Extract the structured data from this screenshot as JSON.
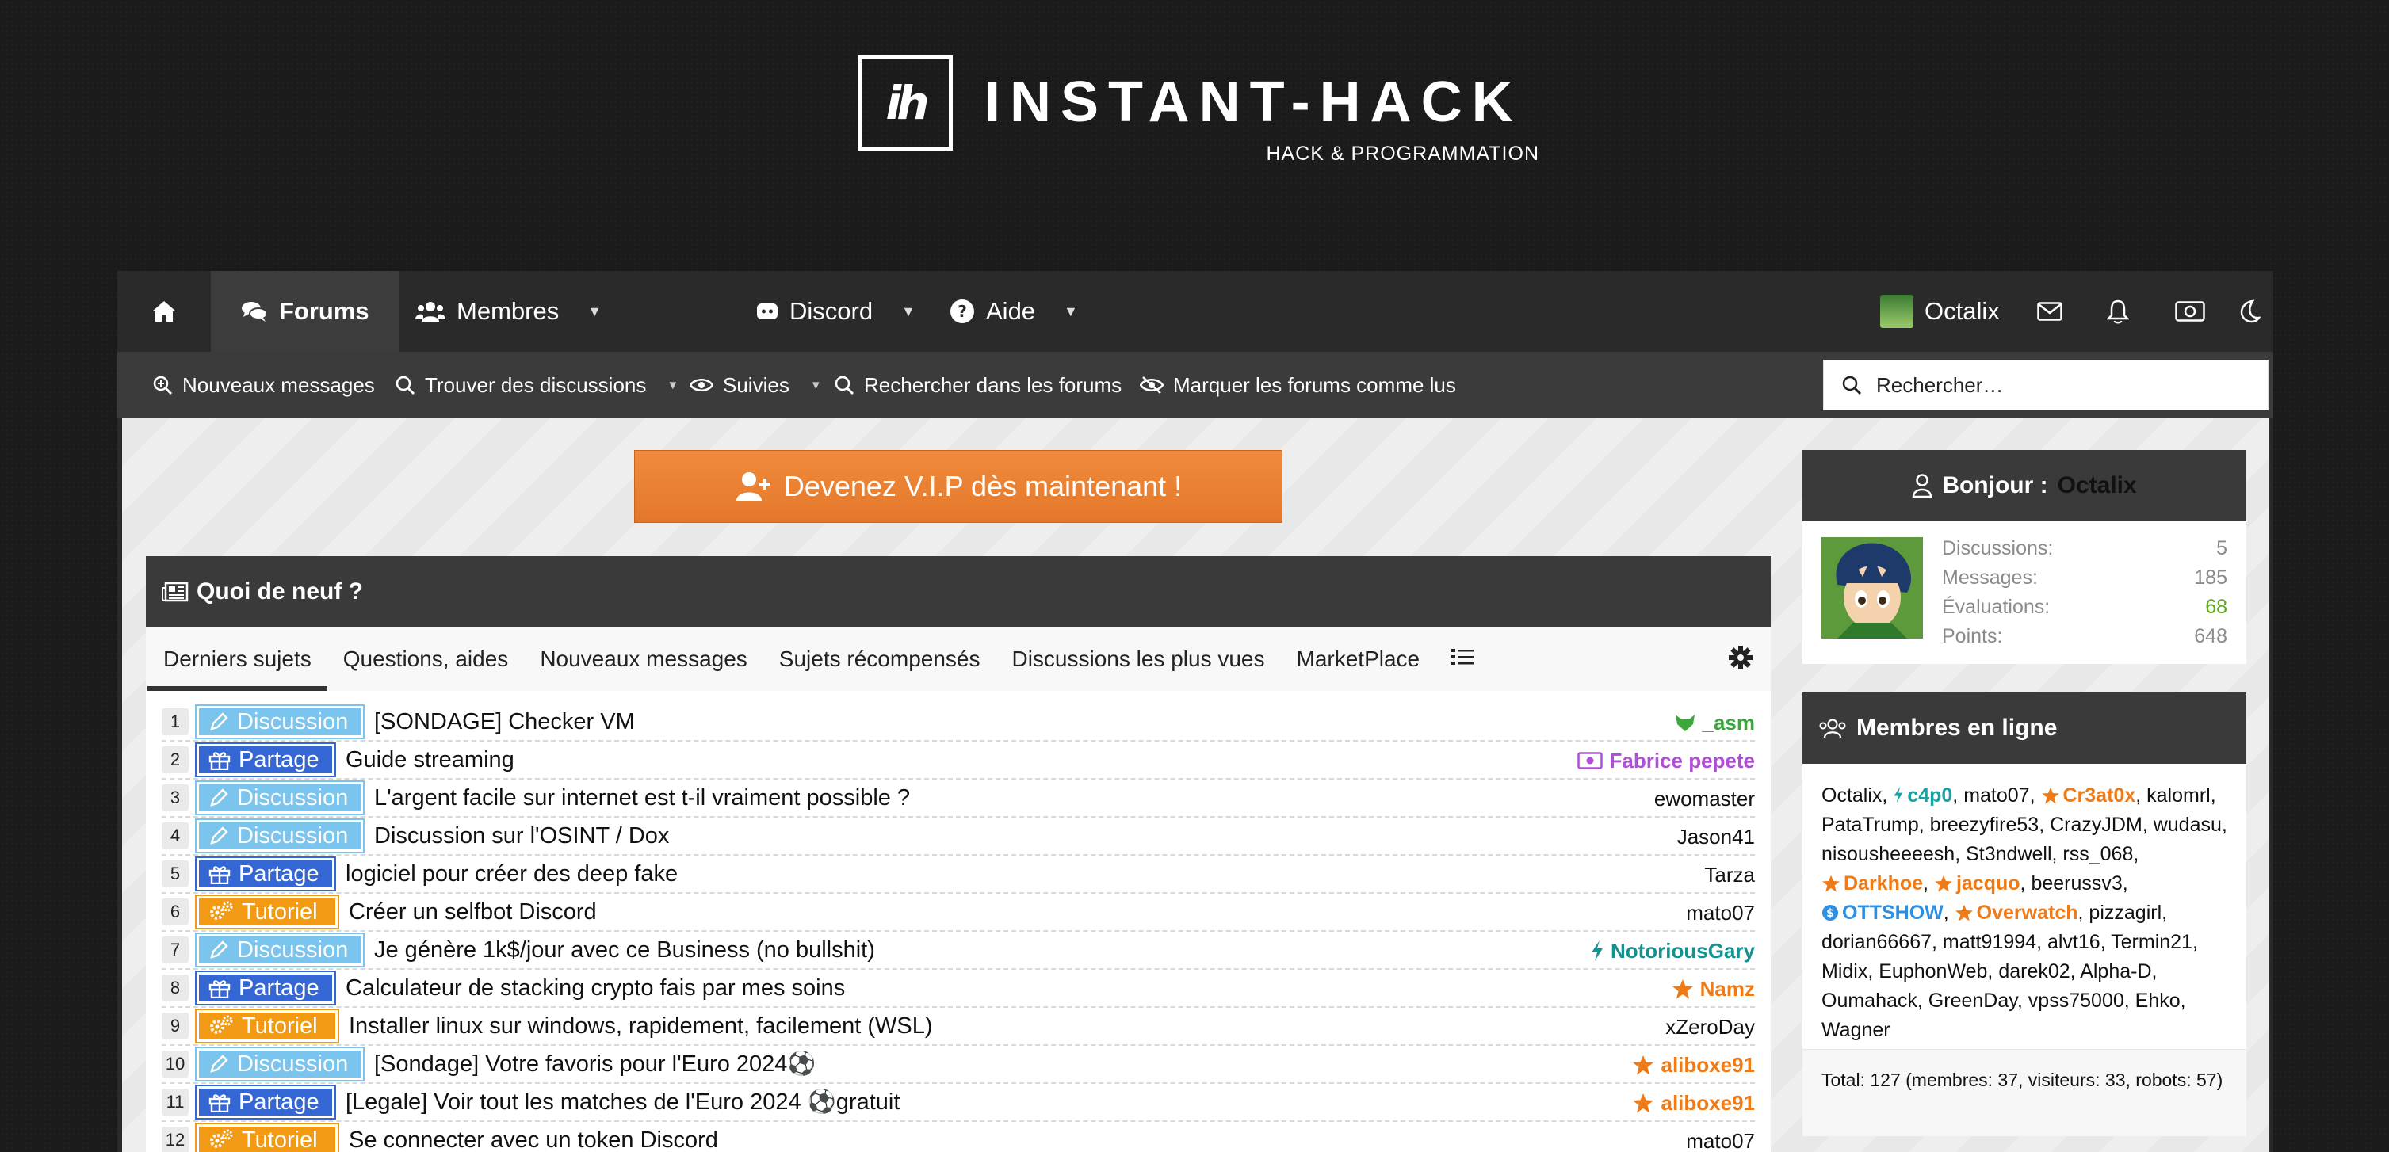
{
  "logo": {
    "mark": "ih",
    "title": "INSTANT-HACK",
    "subtitle": "HACK & PROGRAMMATION"
  },
  "nav": {
    "home_icon": "home-icon",
    "items": [
      {
        "label": "Forums",
        "icon": "comments-icon",
        "active": true
      },
      {
        "label": "Membres",
        "icon": "users-icon"
      },
      {
        "label": "Discord",
        "icon": "discord-icon"
      },
      {
        "label": "Aide",
        "icon": "question-icon"
      }
    ],
    "user": "Octalix"
  },
  "subnav": {
    "items": [
      "Nouveaux messages",
      "Trouver des discussions",
      "Suivies",
      "Rechercher dans les forums",
      "Marquer les forums comme lus"
    ],
    "search_placeholder": "Rechercher…"
  },
  "vip_button": "Devenez V.I.P dès maintenant !",
  "news": {
    "title": "Quoi de neuf ?",
    "tabs": [
      "Derniers sujets",
      "Questions, aides",
      "Nouveaux messages",
      "Sujets récompensés",
      "Discussions les plus vues",
      "MarketPlace"
    ],
    "threads": [
      {
        "n": "1",
        "prefix": "Discussion",
        "title": "[SONDAGE] Checker VM",
        "author": "_asm",
        "author_color": "#3aa83a",
        "badge": "fox"
      },
      {
        "n": "2",
        "prefix": "Partage",
        "title": "Guide streaming",
        "author": "Fabrice pepete",
        "author_color": "#b04fd6",
        "badge": "money"
      },
      {
        "n": "3",
        "prefix": "Discussion",
        "title": "L'argent facile sur internet est t-il vraiment possible ?",
        "author": "ewomaster",
        "author_color": "#111111",
        "badge": ""
      },
      {
        "n": "4",
        "prefix": "Discussion",
        "title": "Discussion sur l'OSINT / Dox",
        "author": "Jason41",
        "author_color": "#111111",
        "badge": ""
      },
      {
        "n": "5",
        "prefix": "Partage",
        "title": "logiciel pour créer des deep fake",
        "author": "Tarza",
        "author_color": "#111111",
        "badge": ""
      },
      {
        "n": "6",
        "prefix": "Tutoriel",
        "title": "Créer un selfbot Discord",
        "author": "mato07",
        "author_color": "#111111",
        "badge": ""
      },
      {
        "n": "7",
        "prefix": "Discussion",
        "title": "Je génère 1k$/jour avec ce Business (no bullshit)",
        "author": "NotoriousGary",
        "author_color": "#169191",
        "badge": "bolt"
      },
      {
        "n": "8",
        "prefix": "Partage",
        "title": "Calculateur de stacking crypto fais par mes soins",
        "author": "Namz",
        "author_color": "#f07a16",
        "badge": "star"
      },
      {
        "n": "9",
        "prefix": "Tutoriel",
        "title": "Installer linux sur windows, rapidement, facilement (WSL)",
        "author": "xZeroDay",
        "author_color": "#111111",
        "badge": ""
      },
      {
        "n": "10",
        "prefix": "Discussion",
        "title": "[Sondage] Votre favoris pour l'Euro 2024⚽",
        "author": "aliboxe91",
        "author_color": "#f07a16",
        "badge": "star"
      },
      {
        "n": "11",
        "prefix": "Partage",
        "title": "[Legale] Voir tout les matches de l'Euro 2024 ⚽gratuit",
        "author": "aliboxe91",
        "author_color": "#f07a16",
        "badge": "star"
      },
      {
        "n": "12",
        "prefix": "Tutoriel",
        "title": "Se connecter avec un token Discord",
        "author": "mato07",
        "author_color": "#111111",
        "badge": ""
      }
    ]
  },
  "sidebar": {
    "greeting": "Bonjour :",
    "user": "Octalix",
    "stats": [
      {
        "label": "Discussions:",
        "value": "5",
        "color": "#8a8a8a"
      },
      {
        "label": "Messages:",
        "value": "185",
        "color": "#8a8a8a"
      },
      {
        "label": "Évaluations:",
        "value": "68",
        "color": "#5fa81a"
      },
      {
        "label": "Points:",
        "value": "648",
        "color": "#8a8a8a"
      }
    ],
    "online_title": "Membres en ligne",
    "online_members": [
      {
        "name": "Octalix",
        "type": ""
      },
      {
        "name": "c4p0",
        "type": "mod"
      },
      {
        "name": "mato07",
        "type": ""
      },
      {
        "name": "Cr3at0x",
        "type": "vip"
      },
      {
        "name": "kalomrl",
        "type": ""
      },
      {
        "name": "PataTrump",
        "type": ""
      },
      {
        "name": "breezyfire53",
        "type": ""
      },
      {
        "name": "CrazyJDM",
        "type": ""
      },
      {
        "name": "wudasu",
        "type": ""
      },
      {
        "name": "nisousheeeesh",
        "type": ""
      },
      {
        "name": "St3ndwell",
        "type": ""
      },
      {
        "name": "rss_068",
        "type": ""
      },
      {
        "name": "Darkhoe",
        "type": "vip"
      },
      {
        "name": "jacquo",
        "type": "vip"
      },
      {
        "name": "beerussv3",
        "type": ""
      },
      {
        "name": "OTTSHOW",
        "type": "staff"
      },
      {
        "name": "Overwatch",
        "type": "vip"
      },
      {
        "name": "pizzagirl",
        "type": ""
      },
      {
        "name": "dorian66667",
        "type": ""
      },
      {
        "name": "matt91994",
        "type": ""
      },
      {
        "name": "alvt16",
        "type": ""
      },
      {
        "name": "Termin21",
        "type": ""
      },
      {
        "name": "Midix",
        "type": ""
      },
      {
        "name": "EuphonWeb",
        "type": ""
      },
      {
        "name": "darek02",
        "type": ""
      },
      {
        "name": "Alpha-D",
        "type": ""
      },
      {
        "name": "Oumahack",
        "type": ""
      },
      {
        "name": "GreenDay",
        "type": ""
      },
      {
        "name": "vpss75000",
        "type": ""
      },
      {
        "name": "Ehko",
        "type": ""
      },
      {
        "name": "Wagner",
        "type": ""
      }
    ],
    "total": "Total: 127 (membres: 37, visiteurs: 33, robots: 57)"
  }
}
